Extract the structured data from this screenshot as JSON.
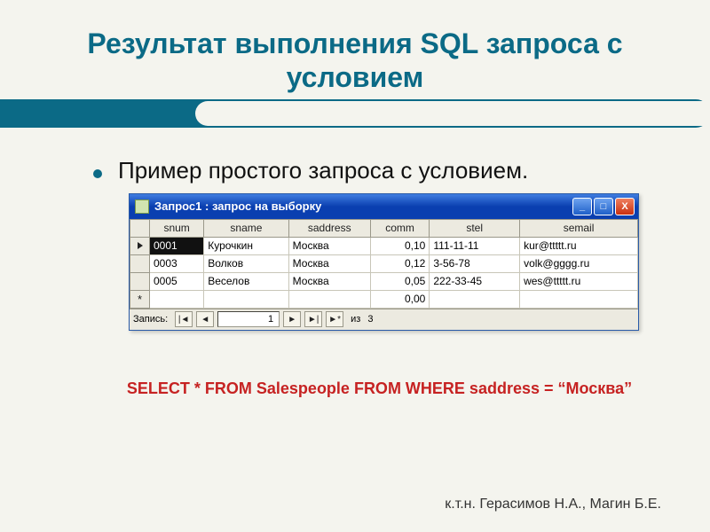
{
  "title": "Результат выполнения SQL запроса с условием",
  "bullet": "Пример простого запроса с условием.",
  "window": {
    "title": "Запрос1 : запрос на выборку",
    "columns": [
      "snum",
      "sname",
      "saddress",
      "comm",
      "stel",
      "semail"
    ],
    "rows": [
      {
        "snum": "0001",
        "sname": "Курочкин",
        "saddress": "Москва",
        "comm": "0,10",
        "stel": "111-11-11",
        "semail": "kur@ttttt.ru"
      },
      {
        "snum": "0003",
        "sname": "Волков",
        "saddress": "Москва",
        "comm": "0,12",
        "stel": "3-56-78",
        "semail": "volk@gggg.ru"
      },
      {
        "snum": "0005",
        "sname": "Веселов",
        "saddress": "Москва",
        "comm": "0,05",
        "stel": "222-33-45",
        "semail": "wes@ttttt.ru"
      }
    ],
    "new_row_comm": "0,00",
    "nav": {
      "label": "Запись:",
      "current": "1",
      "of_label": "из",
      "total": "3"
    }
  },
  "sql": "SELECT * FROM Salespeople FROM WHERE saddress = “Москва”",
  "author": "к.т.н. Герасимов Н.А., Магин Б.Е.",
  "icons": {
    "first": "|◄",
    "prev": "◄",
    "next": "►",
    "last": "►|",
    "new": "►*",
    "min": "_",
    "max": "□",
    "close": "X"
  }
}
